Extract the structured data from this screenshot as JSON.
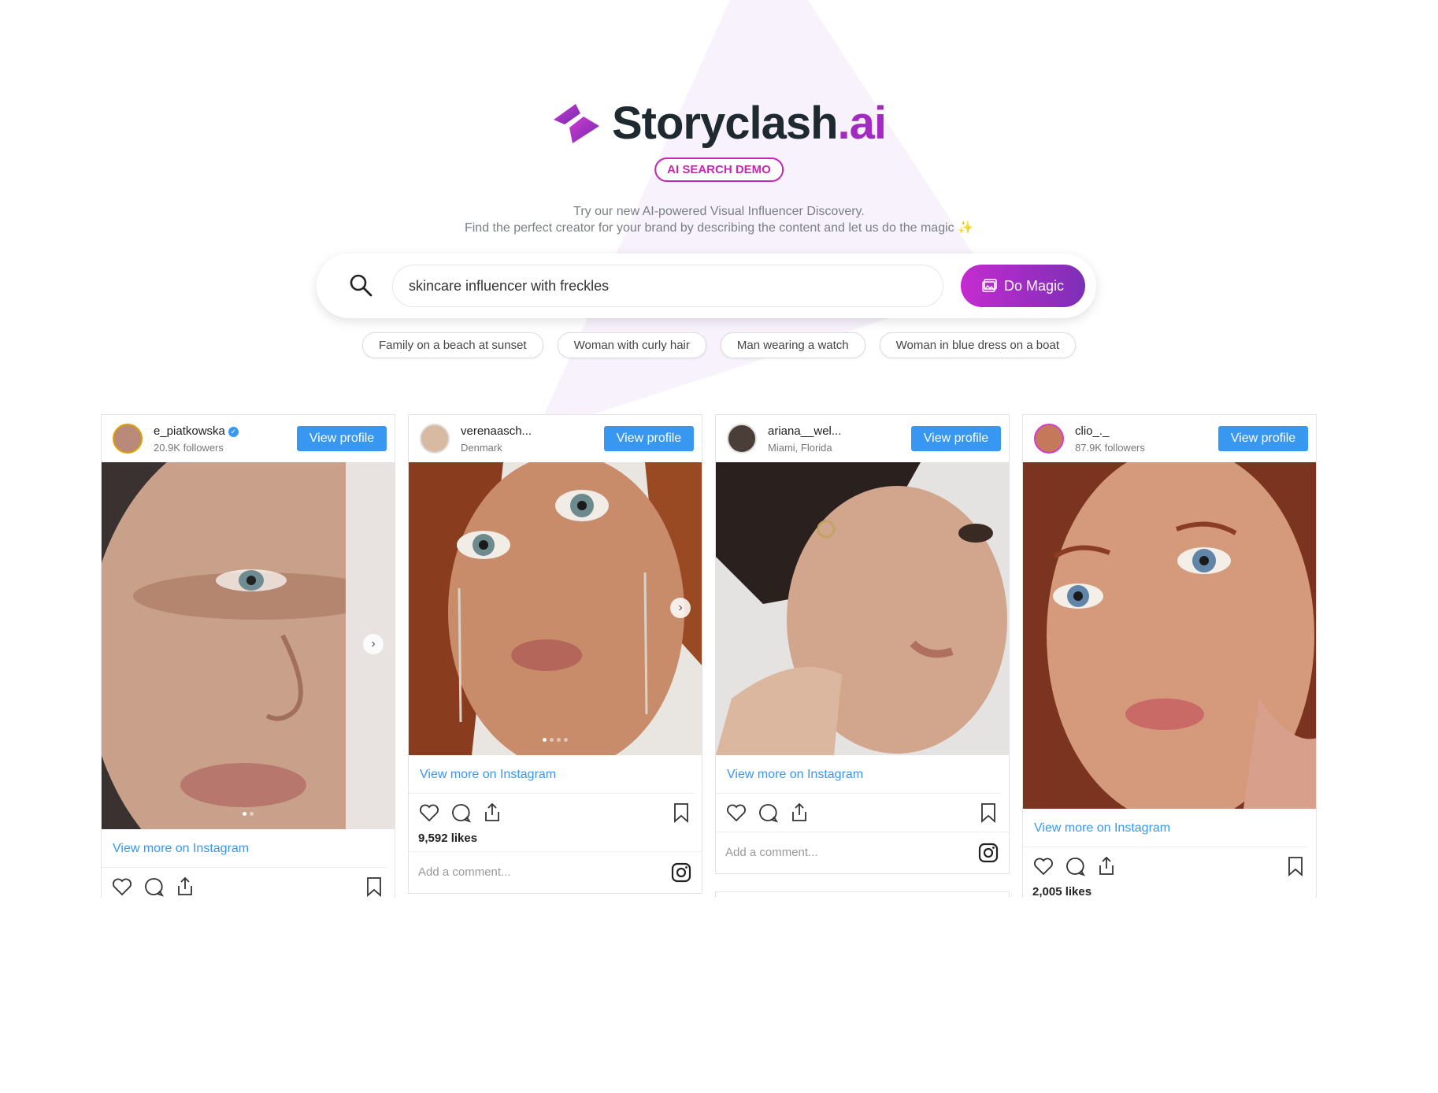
{
  "brand": {
    "name": "Storyclash",
    "tld": ".ai",
    "badge": "AI SEARCH DEMO"
  },
  "tagline": {
    "line1": "Try our new AI-powered Visual Influencer Discovery.",
    "line2": "Find the perfect creator for your brand by describing the content and let us do the magic ✨"
  },
  "search": {
    "value": "skincare influencer with freckles",
    "button_label": "Do Magic"
  },
  "suggestions": [
    "Family on a beach at sunset",
    "Woman with curly hair",
    "Man wearing a watch",
    "Woman in blue dress on a boat"
  ],
  "cards": [
    {
      "username": "e_piatkowska",
      "subtitle": "20.9K followers",
      "verified": true,
      "view_profile": "View profile",
      "view_more": "View more on Instagram",
      "likes": "",
      "comment_placeholder": ""
    },
    {
      "username": "verenaasch...",
      "subtitle": "Denmark",
      "verified": false,
      "view_profile": "View profile",
      "view_more": "View more on Instagram",
      "likes": "9,592 likes",
      "comment_placeholder": "Add a comment..."
    },
    {
      "username": "ariana__wel...",
      "subtitle": "Miami, Florida",
      "verified": false,
      "view_profile": "View profile",
      "view_more": "View more on Instagram",
      "likes": "",
      "comment_placeholder": "Add a comment..."
    },
    {
      "username": "clio_._",
      "subtitle": "87.9K followers",
      "verified": false,
      "view_profile": "View profile",
      "view_more": "View more on Instagram",
      "likes": "2,005 likes",
      "comment_placeholder": ""
    }
  ],
  "colors": {
    "brand_purple": "#a22ac0",
    "accent_blue": "#3897f0",
    "button_gradient_start": "#c42bd0",
    "button_gradient_end": "#7d2fb7"
  }
}
